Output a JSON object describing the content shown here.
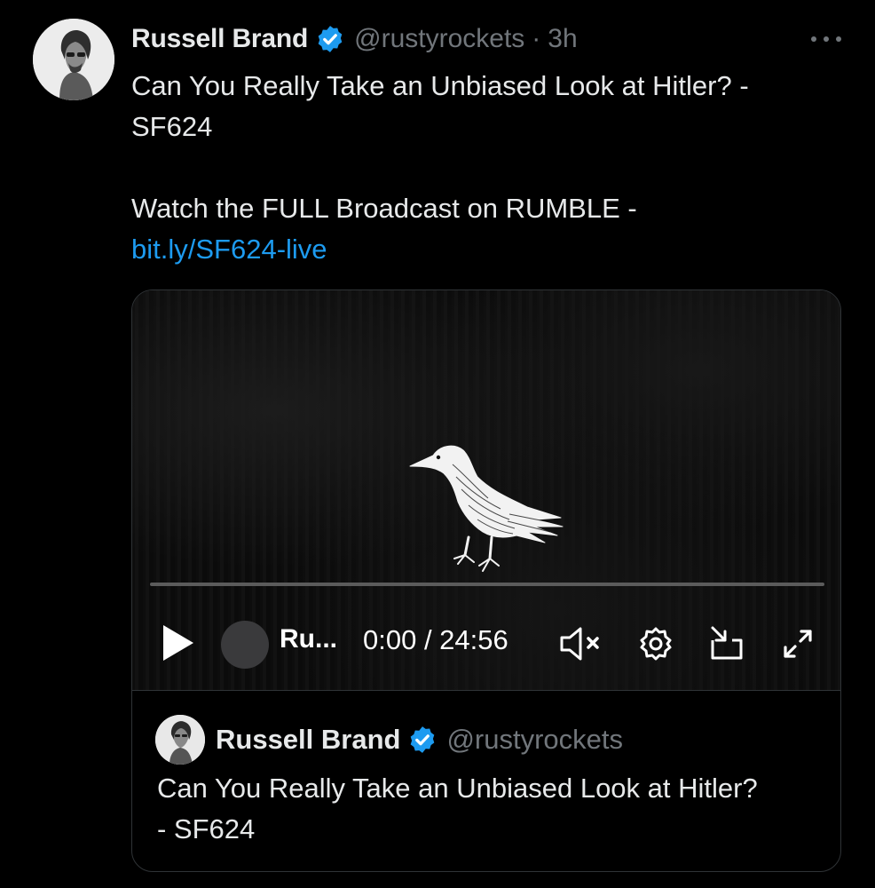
{
  "tweet": {
    "author_name": "Russell Brand",
    "handle": "@rustyrockets",
    "separator": "·",
    "time_ago": "3h",
    "text_line1": "Can You Really Take an Unbiased Look at Hitler? -",
    "text_line2": "SF624",
    "text_line3": "Watch the FULL Broadcast on RUMBLE -",
    "link": "bit.ly/SF624-live"
  },
  "video": {
    "channel_name": "Ru...",
    "time": "0:00 / 24:56",
    "progress": 0
  },
  "quoted": {
    "author_name": "Russell Brand",
    "handle": "@rustyrockets",
    "text_line1": "Can You Really Take an Unbiased Look at Hitler?",
    "text_line2": "- SF624"
  },
  "colors": {
    "background": "#000000",
    "text": "#e7e9ea",
    "muted": "#71767b",
    "link": "#1d9bf0",
    "verified": "#1d9bf0",
    "border": "#2f3336"
  },
  "icons": [
    "verified-badge-icon",
    "more-icon",
    "play-icon",
    "mute-icon",
    "settings-icon",
    "picture-in-picture-icon",
    "fullscreen-icon",
    "raven-image"
  ]
}
